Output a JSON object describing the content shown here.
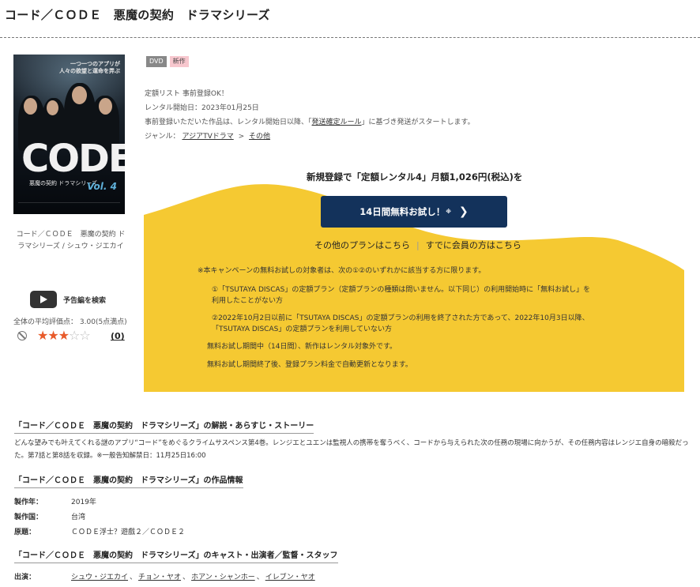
{
  "page_title": "コード／ＣＯＤＥ　悪魔の契約　ドラマシリーズ",
  "poster": {
    "tagline_1": "一つ一つのアプリが",
    "tagline_2": "人々の欲望と運命を弄ぶ",
    "code_text": "CODE",
    "subtitle": "悪魔の契約 ドラマシリーズ",
    "vol": "Vol. 4"
  },
  "poster_caption": "コード／ＣＯＤＥ　悪魔の契約 ドラマシリーズ / シュウ・ジエカイ",
  "trailer_label": "予告編を検索",
  "rating": {
    "label": "全体の平均評価点：",
    "value": "3.00",
    "scale": "(5点満点)",
    "stars_filled": 3,
    "stars_total": 5,
    "review_count": "(0)"
  },
  "badges": {
    "dvd": "DVD",
    "new": "新作"
  },
  "info": {
    "line1": "定額リスト 事前登録OK！",
    "line2": "レンタル開始日：2023年01月25日",
    "line3_pre": "事前登録いただいた作品は、レンタル開始日以降、「",
    "line3_link": "発送確定ルール",
    "line3_post": "」に基づき発送がスタートします。",
    "genre_label": "ジャンル：",
    "genre_1": "アジアTVドラマ",
    "genre_arrow": ">",
    "genre_2": "その他"
  },
  "promo": {
    "headline": "新規登録で「定額レンタル4」月額1,026円(税込)を",
    "cta_label": "14日間無料お試し！",
    "cta_note": "※",
    "link_other_plans": "その他のプランはこちら",
    "link_members": "すでに会員の方はこちら",
    "note_intro": "※本キャンペーンの無料お試しの対象者は、次の①②のいずれかに該当する方に限ります。",
    "note_1a": "①「TSUTAYA DISCAS」の定額プラン（定額プランの種類は問いません。以下同じ）の利用開始時に「無料お試し」を",
    "note_1b": "利用したことがない方",
    "note_2a": "②2022年10月2日以前に「TSUTAYA DISCAS」の定額プランの利用を終了された方であって、2022年10月3日以降、",
    "note_2b": "「TSUTAYA DISCAS」の定額プランを利用していない方",
    "note_3": "無料お試し期間中（14日間）、新作はレンタル対象外です。",
    "note_4": "無料お試し期間終了後、登録プラン料金で自動更新となります。",
    "bg_color": "#f5c932"
  },
  "synopsis_section": {
    "heading": "「コード／ＣＯＤＥ　悪魔の契約　ドラマシリーズ」の解説・あらすじ・ストーリー",
    "text": "どんな望みでも叶えてくれる謎のアプリ“コード”をめぐるクライムサスペンス第4巻。レンジエとユエンは監視人の携帯を奪うべく、コードから与えられた次の任務の現場に向かうが、その任務内容はレンジエ自身の暗殺だった。第7話と第8話を収録。※一般告知解禁日：11月25日16:00"
  },
  "works_section": {
    "heading": "「コード／ＣＯＤＥ　悪魔の契約　ドラマシリーズ」の作品情報",
    "rows": [
      {
        "key": "製作年：",
        "value": "2019年"
      },
      {
        "key": "製作国：",
        "value": "台湾"
      },
      {
        "key": "原題：",
        "value": "ＣＯＤＥ浮士？遊戲２／ＣＯＤＥ２"
      }
    ]
  },
  "cast_section": {
    "heading": "「コード／ＣＯＤＥ　悪魔の契約　ドラマシリーズ」のキャスト・出演者／監督・スタッフ",
    "label": "出演：",
    "names": [
      "シュウ・ジエカイ",
      "チョン・ヤオ",
      "ホアン・シャンホー",
      "イレブン・ヤオ"
    ],
    "separator": "、"
  }
}
